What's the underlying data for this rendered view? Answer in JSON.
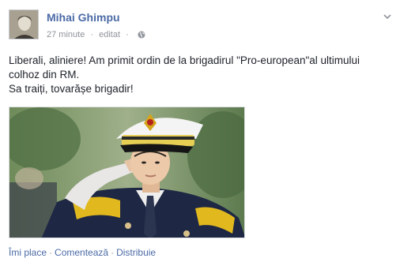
{
  "post": {
    "author": "Mihai Ghimpu",
    "time": "27 minute",
    "edited": "editat",
    "privacy_icon": "globe-icon",
    "options_icon": "chevron-down-icon",
    "text_line1": "Liberali, aliniere! Am primit ordin de la brigadirul \"Pro-european\"al ultimului colhoz din RM.",
    "text_line2": "Sa traiți, tovarășe brigadir!",
    "photo_icon": "saluting-officer-photo"
  },
  "actions": {
    "like": "Îmi place",
    "comment": "Comentează",
    "share": "Distribuie",
    "separator": "·"
  },
  "colors": {
    "link": "#3b5998",
    "meta": "#90949c",
    "text": "#1d2129"
  }
}
